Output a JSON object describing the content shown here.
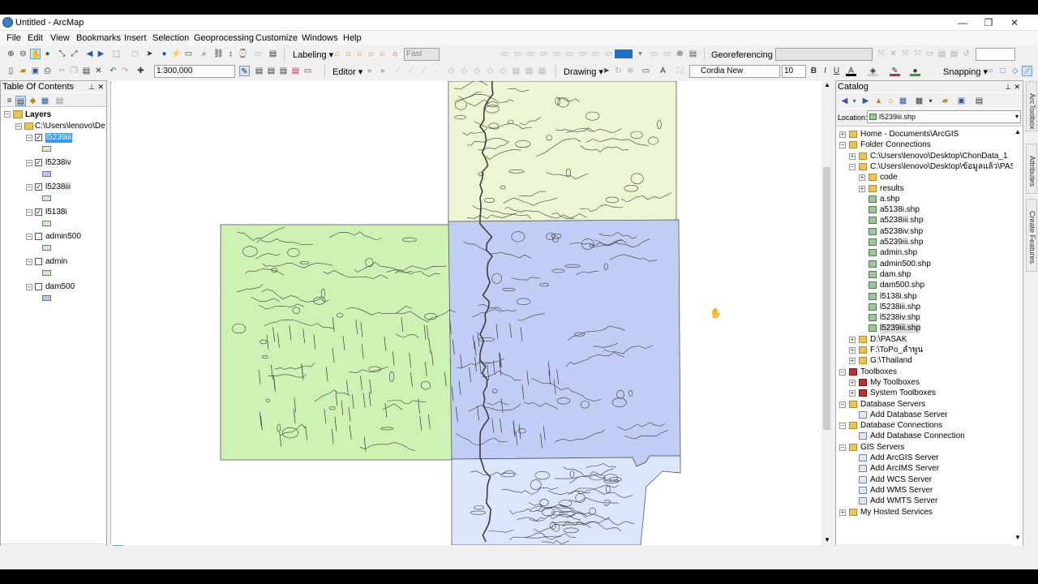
{
  "window": {
    "title": "Untitled - ArcMap",
    "minimize": "—",
    "restore": "❐",
    "close": "✕"
  },
  "menu": [
    "File",
    "Edit",
    "View",
    "Bookmarks",
    "Insert",
    "Selection",
    "Geoprocessing",
    "Customize",
    "Windows",
    "Help"
  ],
  "toolbar": {
    "labeling": "Labeling ▾",
    "fast": "Fast",
    "georeferencing": "Georeferencing ▾",
    "scale": "1:300,000",
    "editor": "Editor ▾",
    "drawing": "Drawing ▾",
    "font": "Cordia New",
    "font_size": "10",
    "snapping": "Snapping ▾",
    "bold": "B",
    "italic": "I",
    "underline": "U"
  },
  "toc": {
    "title": "Table Of Contents",
    "root": "Layers",
    "frame": "C:\\Users\\lenovo\\De",
    "layers": [
      {
        "name": "l5239iii",
        "checked": true,
        "color": "#d9f2b8",
        "selected": true
      },
      {
        "name": "l5238iv",
        "checked": true,
        "color": "#b8c8f0",
        "selected": false
      },
      {
        "name": "l5238iii",
        "checked": true,
        "color": "#c8e8f4",
        "selected": false
      },
      {
        "name": "l5138i",
        "checked": true,
        "color": "#c8f0b8",
        "selected": false
      },
      {
        "name": "admin500",
        "checked": false,
        "color": "#c8f0e0",
        "selected": false
      },
      {
        "name": "admin",
        "checked": false,
        "color": "#c8f0c8",
        "selected": false
      },
      {
        "name": "dam500",
        "checked": false,
        "color": "#b8c8e8",
        "selected": false
      }
    ]
  },
  "catalog": {
    "title": "Catalog",
    "location_label": "Location:",
    "location_value": "l5239iii.shp",
    "items": [
      {
        "label": "Home - Documents\\ArcGIS",
        "level": 0,
        "exp": "+",
        "icon": "folder"
      },
      {
        "label": "Folder Connections",
        "level": 0,
        "exp": "−",
        "icon": "folder"
      },
      {
        "label": "C:\\Users\\lenovo\\Desktop\\ChonData_1",
        "level": 1,
        "exp": "+",
        "icon": "folder"
      },
      {
        "label": "C:\\Users\\lenovo\\Desktop\\ข้อมูลแล้ว\\PASAK",
        "level": 1,
        "exp": "−",
        "icon": "folder"
      },
      {
        "label": "code",
        "level": 2,
        "exp": "+",
        "icon": "folder"
      },
      {
        "label": "results",
        "level": 2,
        "exp": "+",
        "icon": "folder"
      },
      {
        "label": "a.shp",
        "level": 2,
        "exp": "",
        "icon": "shp"
      },
      {
        "label": "a5138i.shp",
        "level": 2,
        "exp": "",
        "icon": "shp"
      },
      {
        "label": "a5238iii.shp",
        "level": 2,
        "exp": "",
        "icon": "shp"
      },
      {
        "label": "a5238iv.shp",
        "level": 2,
        "exp": "",
        "icon": "shp"
      },
      {
        "label": "a5239iii.shp",
        "level": 2,
        "exp": "",
        "icon": "shp"
      },
      {
        "label": "admin.shp",
        "level": 2,
        "exp": "",
        "icon": "shp"
      },
      {
        "label": "admin500.shp",
        "level": 2,
        "exp": "",
        "icon": "shp"
      },
      {
        "label": "dam.shp",
        "level": 2,
        "exp": "",
        "icon": "shp"
      },
      {
        "label": "dam500.shp",
        "level": 2,
        "exp": "",
        "icon": "shp"
      },
      {
        "label": "l5138i.shp",
        "level": 2,
        "exp": "",
        "icon": "shp"
      },
      {
        "label": "l5238iii.shp",
        "level": 2,
        "exp": "",
        "icon": "shp"
      },
      {
        "label": "l5238iv.shp",
        "level": 2,
        "exp": "",
        "icon": "shp"
      },
      {
        "label": "l5239iii.shp",
        "level": 2,
        "exp": "",
        "icon": "shp"
      },
      {
        "label": "D:\\PASAK",
        "level": 1,
        "exp": "+",
        "icon": "folder"
      },
      {
        "label": "F:\\ToPo_ลำพูน",
        "level": 1,
        "exp": "+",
        "icon": "folder"
      },
      {
        "label": "G:\\Thailand",
        "level": 1,
        "exp": "+",
        "icon": "folder"
      },
      {
        "label": "Toolboxes",
        "level": 0,
        "exp": "−",
        "icon": "toolbox"
      },
      {
        "label": "My Toolboxes",
        "level": 1,
        "exp": "+",
        "icon": "toolbox"
      },
      {
        "label": "System Toolboxes",
        "level": 1,
        "exp": "+",
        "icon": "toolbox"
      },
      {
        "label": "Database Servers",
        "level": 0,
        "exp": "−",
        "icon": "folder"
      },
      {
        "label": "Add Database Server",
        "level": 1,
        "exp": "",
        "icon": "add"
      },
      {
        "label": "Database Connections",
        "level": 0,
        "exp": "−",
        "icon": "folder"
      },
      {
        "label": "Add Database Connection",
        "level": 1,
        "exp": "",
        "icon": "add"
      },
      {
        "label": "GIS Servers",
        "level": 0,
        "exp": "−",
        "icon": "folder"
      },
      {
        "label": "Add ArcGIS Server",
        "level": 1,
        "exp": "",
        "icon": "add"
      },
      {
        "label": "Add ArcIMS Server",
        "level": 1,
        "exp": "",
        "icon": "add"
      },
      {
        "label": "Add WCS Server",
        "level": 1,
        "exp": "",
        "icon": "add"
      },
      {
        "label": "Add WMS Server",
        "level": 1,
        "exp": "",
        "icon": "add"
      },
      {
        "label": "Add WMTS Server",
        "level": 1,
        "exp": "",
        "icon": "add"
      },
      {
        "label": "My Hosted Services",
        "level": 0,
        "exp": "+",
        "icon": "folder"
      }
    ]
  },
  "side_tabs": [
    "ArcToolbox",
    "Attributes",
    "Create Features"
  ],
  "map_colors": {
    "north": "#eaf7d2",
    "west": "#cdf2b4",
    "east": "#c1cdf5",
    "south": "#dbe5fb",
    "line": "#3c3c3c"
  }
}
